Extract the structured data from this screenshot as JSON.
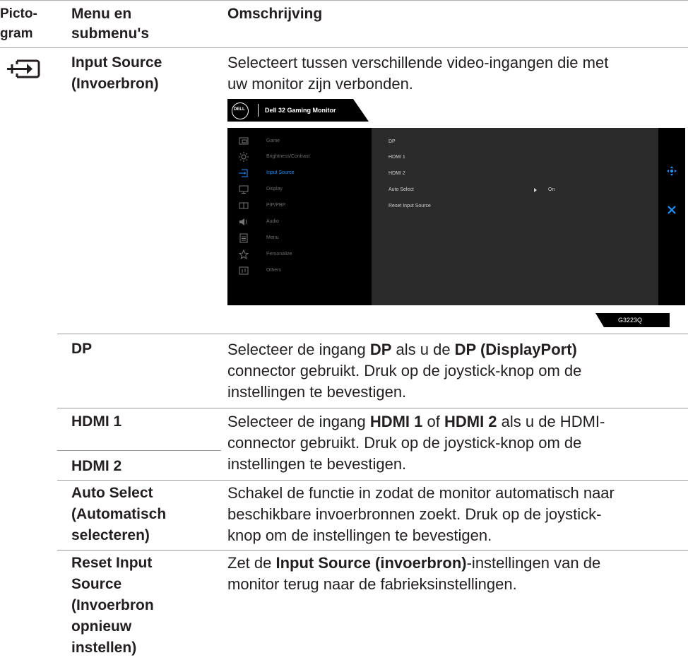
{
  "headers": {
    "col1": "Picto-\ngram",
    "col2": "Menu en\nsubmenu's",
    "col3": "Omschrijving"
  },
  "input_source": {
    "title": "Input Source\n(Invoerbron)",
    "description": "Selecteert tussen verschillende video-ingangen die met\nuw monitor zijn verbonden."
  },
  "osd": {
    "brand": "DELL",
    "tab_title": "Dell 32 Gaming Monitor",
    "menu": [
      {
        "label": "Game",
        "icon": "game-icon",
        "active": false
      },
      {
        "label": "Brightness/Contrast",
        "icon": "brightness-icon",
        "active": false
      },
      {
        "label": "Input Source",
        "icon": "input-source-icon",
        "active": true
      },
      {
        "label": "Display",
        "icon": "display-icon",
        "active": false
      },
      {
        "label": "PIP/PBP",
        "icon": "pip-icon",
        "active": false
      },
      {
        "label": "Audio",
        "icon": "audio-icon",
        "active": false
      },
      {
        "label": "Menu",
        "icon": "menu-icon",
        "active": false
      },
      {
        "label": "Personalize",
        "icon": "star-icon",
        "active": false
      },
      {
        "label": "Others",
        "icon": "others-icon",
        "active": false
      }
    ],
    "submenu": [
      "DP",
      "HDMI 1",
      "HDMI 2",
      "Auto Select",
      "Reset Input Source"
    ],
    "auto_select_value": "On",
    "model": "G3223Q",
    "colors": {
      "active": "#1e90ff",
      "panel": "#2b2b2b",
      "bg": "#000000"
    }
  },
  "rows": {
    "dp": {
      "title": "DP",
      "desc_p1": "Selecteer de ingang ",
      "desc_b1": "DP",
      "desc_p2": " als u de ",
      "desc_b2": "DP (DisplayPort)",
      "desc_p3": "connector gebruikt. Druk op de joystick-knop om de\ninstellingen te bevestigen."
    },
    "hdmi": {
      "title1": "HDMI 1",
      "title2": "HDMI 2",
      "desc_p1": "Selecteer de ingang ",
      "desc_b1": "HDMI 1",
      "desc_p2": " of ",
      "desc_b2": "HDMI 2",
      "desc_p3": " als u de HDMI-",
      "desc_p4": "connector gebruikt. Druk op de joystick-knop om de\ninstellingen te bevestigen."
    },
    "auto": {
      "title": "Auto Select\n(Automatisch\nselecteren)",
      "desc": "Schakel de functie in zodat de monitor automatisch naar\nbeschikbare invoerbronnen zoekt. Druk op de joystick-\nknop om de instellingen te bevestigen."
    },
    "reset": {
      "title": "Reset Input\nSource\n(Invoerbron\nopnieuw\ninstellen)",
      "desc_p1": "Zet de ",
      "desc_b1": "Input Source (invoerbron)",
      "desc_p2": "-instellingen van de",
      "desc_p3": "monitor terug naar de fabrieksinstellingen."
    }
  }
}
